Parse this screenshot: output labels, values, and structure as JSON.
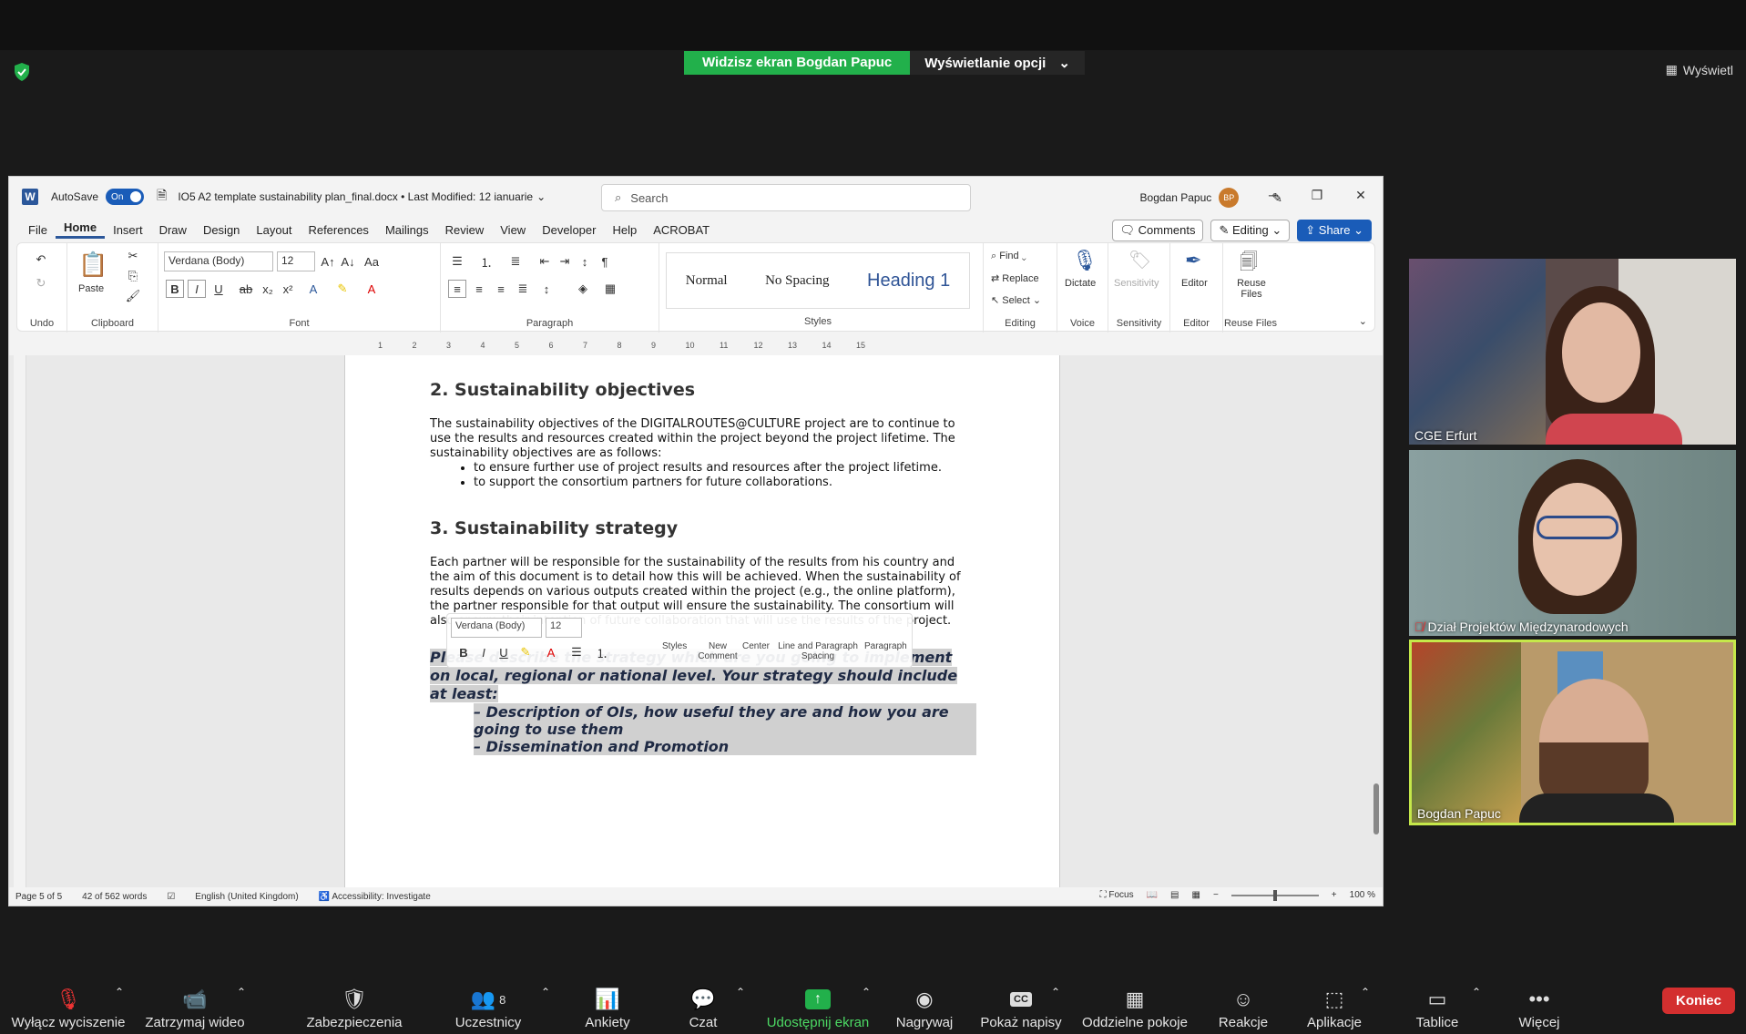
{
  "zoom": {
    "banner_text": "Widzisz ekran Bogdan Papuc",
    "view_options": "Wyświetlanie opcji",
    "view_button": "Wyświetl",
    "end_button": "Koniec",
    "toolbar": [
      {
        "label": "Wyłącz wyciszenie",
        "icon": "mic-muted-icon"
      },
      {
        "label": "Zatrzymaj wideo",
        "icon": "video-icon"
      },
      {
        "label": "Zabezpieczenia",
        "icon": "security-shield-icon"
      },
      {
        "label": "Uczestnicy",
        "icon": "participants-icon",
        "count": "8"
      },
      {
        "label": "Ankiety",
        "icon": "polls-icon"
      },
      {
        "label": "Czat",
        "icon": "chat-icon"
      },
      {
        "label": "Udostępnij ekran",
        "icon": "share-screen-icon"
      },
      {
        "label": "Nagrywaj",
        "icon": "record-icon"
      },
      {
        "label": "Pokaż napisy",
        "icon": "captions-icon"
      },
      {
        "label": "Oddzielne pokoje",
        "icon": "breakout-rooms-icon"
      },
      {
        "label": "Reakcje",
        "icon": "reactions-icon"
      },
      {
        "label": "Aplikacje",
        "icon": "apps-icon"
      },
      {
        "label": "Tablice",
        "icon": "whiteboards-icon"
      },
      {
        "label": "Więcej",
        "icon": "more-icon"
      }
    ],
    "participants": [
      {
        "name": "CGE Erfurt",
        "muted": false
      },
      {
        "name": "Dział Projektów Międzynarodowych",
        "muted": true
      },
      {
        "name": "Bogdan Papuc",
        "muted": false,
        "active": true
      }
    ]
  },
  "word": {
    "autosave": "AutoSave",
    "autosave_state": "On",
    "doc_title": "IO5 A2 template sustainability plan_final.docx • Last Modified: 12 ianuarie",
    "search_placeholder": "Search",
    "user_name": "Bogdan Papuc",
    "user_initials": "BP",
    "menu_tabs": [
      "File",
      "Home",
      "Insert",
      "Draw",
      "Design",
      "Layout",
      "References",
      "Mailings",
      "Review",
      "View",
      "Developer",
      "Help",
      "ACROBAT"
    ],
    "comments": "Comments",
    "editing": "Editing",
    "share": "Share",
    "ribbon": {
      "undo_label": "Undo",
      "paste": "Paste",
      "clipboard_label": "Clipboard",
      "font_name": "Verdana (Body)",
      "font_size": "12",
      "font_label": "Font",
      "paragraph_label": "Paragraph",
      "styles": [
        "Normal",
        "No Spacing",
        "Heading 1"
      ],
      "styles_label": "Styles",
      "find": "Find",
      "replace": "Replace",
      "select": "Select",
      "editing_label": "Editing",
      "dictate": "Dictate",
      "voice_label": "Voice",
      "sensitivity": "Sensitivity",
      "sensitivity_label": "Sensitivity",
      "editor": "Editor",
      "editor_label": "Editor",
      "reuse_files": "Reuse Files",
      "reuse_files_label": "Reuse Files"
    },
    "ruler_numbers": [
      "1",
      "2",
      "3",
      "4",
      "5",
      "6",
      "7",
      "8",
      "9",
      "10",
      "11",
      "12",
      "13",
      "14",
      "15"
    ],
    "document": {
      "heading2": "2. Sustainability objectives",
      "para1": "The sustainability objectives of the DIGITALROUTES@CULTURE project are to continue to use the results and resources created within the project beyond the project lifetime. The sustainability objectives are as follows:",
      "bullets": [
        "to ensure further use of project results and resources after the project lifetime.",
        "to support the consortium partners for future collaborations."
      ],
      "heading3": "3. Sustainability strategy",
      "para2": "Each partner will be responsible for the sustainability of the results from his country and the aim of this document is to detail how this will be achieved. When the sustainability of results depends on various outputs created within the project (e.g., the online platform), the partner responsible for that output will ensure the sustainability.",
      "para2b": "The consortium will also ensure their intention of future collaboration that will use the results of the project.",
      "selected_intro": "Please describe the strategy which are you going to implement on local, regional or national level. Your strategy should include at least:",
      "selected_items": [
        "Description of OIs, how useful they are and how you are going to use them",
        "Dissemination and Promotion"
      ]
    },
    "mini_toolbar": {
      "font": "Verdana (Body)",
      "size": "12",
      "styles": "Styles",
      "new_comment": "New Comment",
      "center": "Center",
      "line_spacing": "Line and Paragraph Spacing",
      "paragraph": "Paragraph"
    },
    "status": {
      "page": "Page 5 of 5",
      "words": "42 of 562 words",
      "language": "English (United Kingdom)",
      "accessibility": "Accessibility: Investigate",
      "focus": "Focus",
      "zoom": "100 %"
    }
  }
}
